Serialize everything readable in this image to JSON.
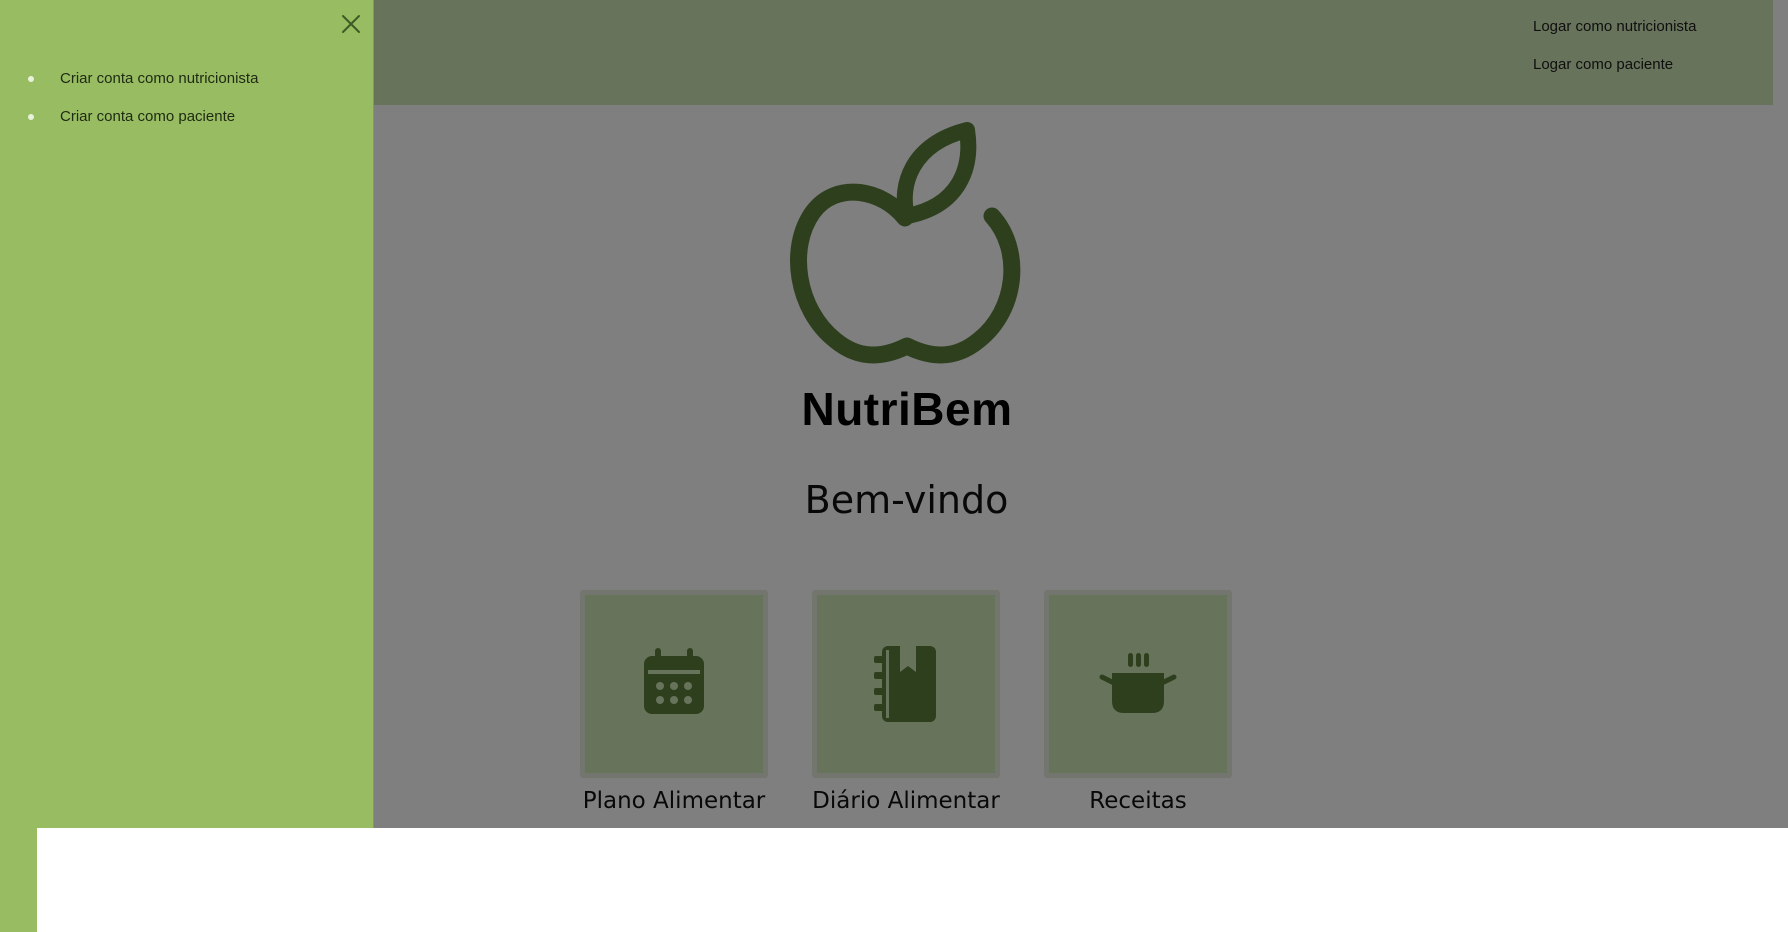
{
  "topbar": {
    "links": [
      "Logar como nutricionista",
      "Logar como paciente"
    ]
  },
  "brand": {
    "name": "NutriBem"
  },
  "welcome": {
    "title": "Bem-vindo"
  },
  "cards": [
    {
      "label": "Plano Alimentar",
      "icon": "calendar-icon"
    },
    {
      "label": "Diário Alimentar",
      "icon": "journal-icon"
    },
    {
      "label": "Receitas",
      "icon": "cooking-pot-icon"
    }
  ],
  "drawer": {
    "items": [
      "Criar conta como nutricionista",
      "Criar conta como paciente"
    ],
    "close_icon": "close-icon"
  },
  "colors": {
    "drawer_bg": "#98bc62",
    "brand_green": "#5b7e3a",
    "topbar_bg": "#cfe6b6",
    "overlay": "rgba(0,0,0,0.5)"
  }
}
